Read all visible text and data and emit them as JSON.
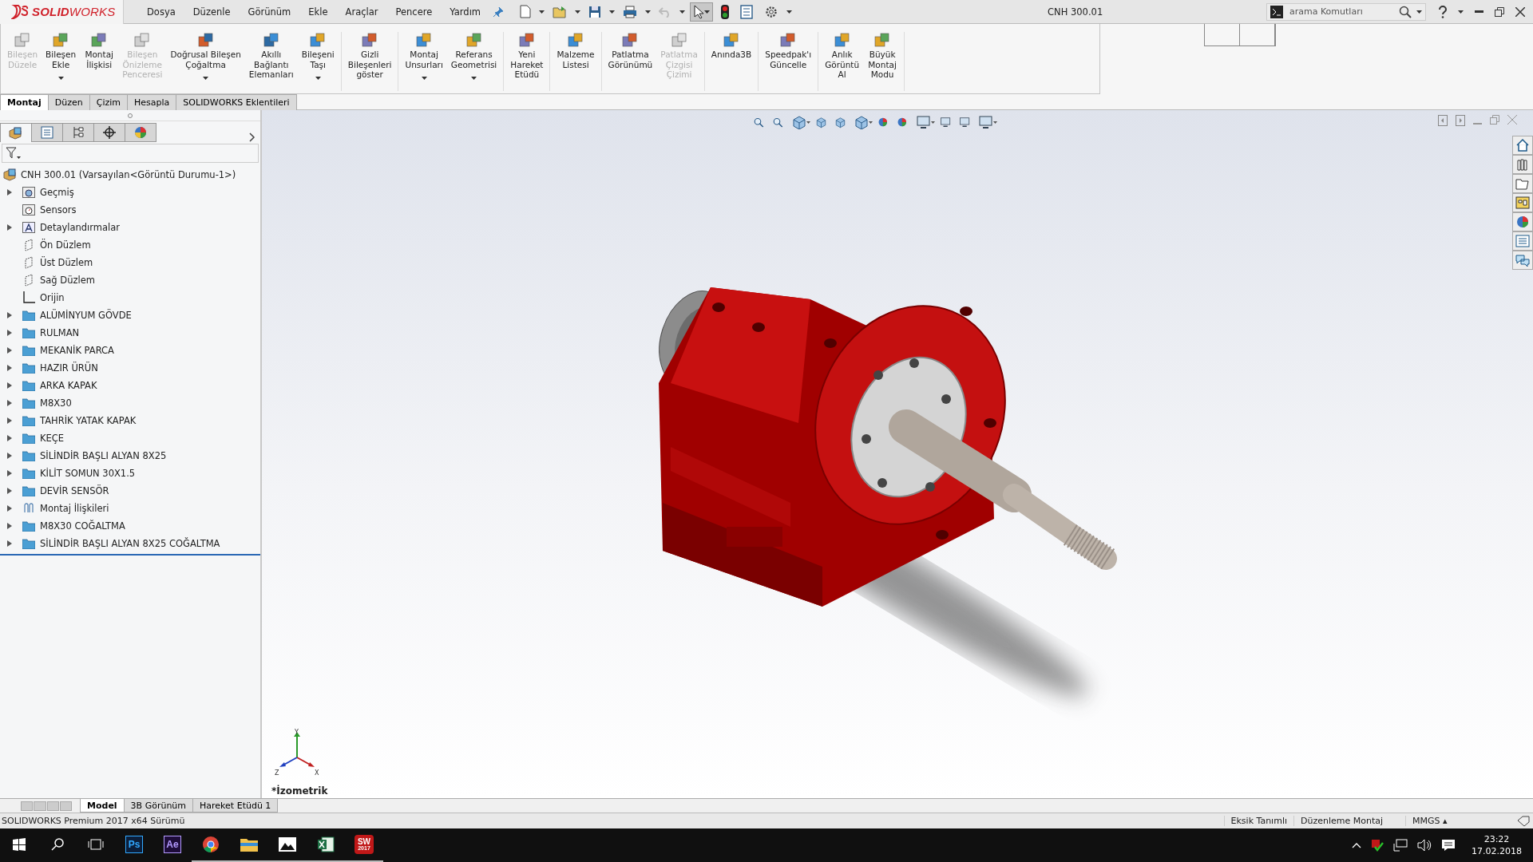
{
  "window": {
    "logo": "**SOLID**WORKS",
    "title": "CNH 300.01"
  },
  "menu": [
    {
      "label": "Dosya"
    },
    {
      "label": "Düzenle"
    },
    {
      "label": "Görünüm"
    },
    {
      "label": "Ekle"
    },
    {
      "label": "Araçlar"
    },
    {
      "label": "Pencere"
    },
    {
      "label": "Yardım"
    }
  ],
  "search": {
    "placeholder": "arama Komutları"
  },
  "ribbon": {
    "groups": [
      {
        "buttons": [
          {
            "label": "Bileşen\nDüzele",
            "disabled": true,
            "dropdown": false
          },
          {
            "label": "Bileşen\nEkle",
            "disabled": false,
            "dropdown": true
          },
          {
            "label": "Montaj\nİlişkisi",
            "disabled": false,
            "dropdown": false
          },
          {
            "label": "Bileşen\nÖnizleme\nPenceresi",
            "disabled": true,
            "dropdown": false
          },
          {
            "label": "Doğrusal Bileşen\nÇoğaltma",
            "disabled": false,
            "dropdown": true
          },
          {
            "label": "Akıllı\nBağlantı\nElemanları",
            "disabled": false,
            "dropdown": false
          },
          {
            "label": "Bileşeni\nTaşı",
            "disabled": false,
            "dropdown": true
          }
        ]
      },
      {
        "buttons": [
          {
            "label": "Gizli\nBileşenleri\ngöster",
            "disabled": false,
            "dropdown": false
          }
        ]
      },
      {
        "buttons": [
          {
            "label": "Montaj\nUnsurları",
            "disabled": false,
            "dropdown": true
          },
          {
            "label": "Referans\nGeometrisi",
            "disabled": false,
            "dropdown": true
          }
        ]
      },
      {
        "buttons": [
          {
            "label": "Yeni\nHareket\nEtüdü",
            "disabled": false,
            "dropdown": false
          }
        ]
      },
      {
        "buttons": [
          {
            "label": "Malzeme\nListesi",
            "disabled": false,
            "dropdown": false
          }
        ]
      },
      {
        "buttons": [
          {
            "label": "Patlatma\nGörünümü",
            "disabled": false,
            "dropdown": false
          },
          {
            "label": "Patlatma\nÇizgisi\nÇizimi",
            "disabled": true,
            "dropdown": false
          }
        ]
      },
      {
        "buttons": [
          {
            "label": "Anında3B",
            "disabled": false,
            "dropdown": false
          }
        ]
      },
      {
        "buttons": [
          {
            "label": "Speedpak'ı\nGüncelle",
            "disabled": false,
            "dropdown": false
          }
        ]
      },
      {
        "buttons": [
          {
            "label": "Anlık\nGörüntü\nAl",
            "disabled": false,
            "dropdown": false
          },
          {
            "label": "Büyük\nMontaj\nModu",
            "disabled": false,
            "dropdown": false
          }
        ]
      }
    ]
  },
  "command_tabs": [
    {
      "label": "Montaj",
      "selected": true
    },
    {
      "label": "Düzen",
      "selected": false
    },
    {
      "label": "Çizim",
      "selected": false
    },
    {
      "label": "Hesapla",
      "selected": false
    },
    {
      "label": "SOLIDWORKS Eklentileri",
      "selected": false
    }
  ],
  "panel_tabs": [
    {
      "selected": true
    },
    {
      "selected": false
    },
    {
      "selected": false
    },
    {
      "selected": false
    },
    {
      "selected": false
    }
  ],
  "tree": {
    "label": "CNH 300.01  (Varsayılan<Görüntü Durumu-1>)",
    "kind": "assembly",
    "children": [
      {
        "label": "Geçmiş",
        "kind": "history",
        "expander": true
      },
      {
        "label": "Sensors",
        "kind": "sensor",
        "expander": false
      },
      {
        "label": "Detaylandırmalar",
        "kind": "annotation",
        "expander": true
      },
      {
        "label": "Ön Düzlem",
        "kind": "plane",
        "expander": false
      },
      {
        "label": "Üst Düzlem",
        "kind": "plane",
        "expander": false
      },
      {
        "label": "Sağ Düzlem",
        "kind": "plane",
        "expander": false
      },
      {
        "label": "Orijin",
        "kind": "origin",
        "expander": false
      },
      {
        "label": "ALÜMİNYUM GÖVDE",
        "kind": "folder",
        "expander": true
      },
      {
        "label": "RULMAN",
        "kind": "folder",
        "expander": true
      },
      {
        "label": "MEKANİK PARCA",
        "kind": "folder",
        "expander": true
      },
      {
        "label": "HAZIR ÜRÜN",
        "kind": "folder",
        "expander": true
      },
      {
        "label": "ARKA KAPAK",
        "kind": "folder",
        "expander": true
      },
      {
        "label": "M8X30",
        "kind": "folder",
        "expander": true
      },
      {
        "label": "TAHRİK YATAK KAPAK",
        "kind": "folder",
        "expander": true
      },
      {
        "label": "KEÇE",
        "kind": "folder",
        "expander": true
      },
      {
        "label": "SİLİNDİR BAŞLI ALYAN 8X25",
        "kind": "folder",
        "expander": true
      },
      {
        "label": "KİLİT SOMUN 30X1.5",
        "kind": "folder",
        "expander": true
      },
      {
        "label": "DEVİR SENSÖR",
        "kind": "folder",
        "expander": true
      },
      {
        "label": "Montaj İlişkileri",
        "kind": "mates",
        "expander": true
      },
      {
        "label": "M8X30 COĞALTMA",
        "kind": "folder",
        "expander": true
      },
      {
        "label": "SİLİNDİR BAŞLI ALYAN 8X25 COĞALTMA",
        "kind": "folder",
        "expander": true
      }
    ]
  },
  "viewport": {
    "view_name": "*İzometrik",
    "axes": [
      "Y",
      "Z",
      "X"
    ]
  },
  "bottom_tabs": [
    {
      "label": "Model",
      "selected": true
    },
    {
      "label": "3B Görünüm",
      "selected": false
    },
    {
      "label": "Hareket Etüdü 1",
      "selected": false
    }
  ],
  "status_bar": {
    "version": "SOLIDWORKS Premium 2017 x64 Sürümü",
    "state": "Eksik Tanımlı",
    "mode": "Düzenleme Montaj",
    "units": "MMGS",
    "units_caret": "▴"
  },
  "taskbar": {
    "apps": [
      {
        "kind": "photoshop",
        "label": "Ps",
        "running": false
      },
      {
        "kind": "aftereffects",
        "label": "Ae",
        "running": false
      },
      {
        "kind": "chrome",
        "running": true
      },
      {
        "kind": "files",
        "running": true
      },
      {
        "kind": "photos",
        "running": true
      },
      {
        "kind": "excel",
        "running": true
      },
      {
        "kind": "solidworks",
        "label": "SW",
        "sublabel": "2017",
        "running": true
      }
    ],
    "time": "23:22",
    "date": "17.02.2018"
  }
}
